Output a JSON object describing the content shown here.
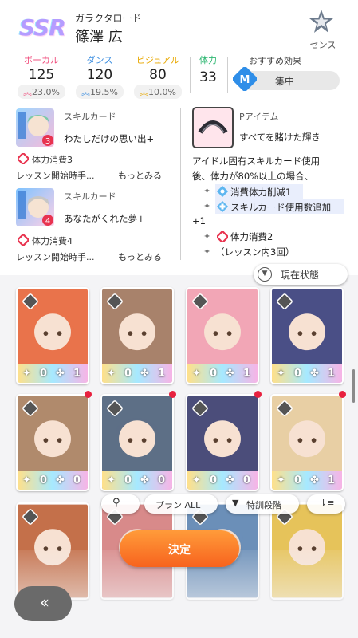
{
  "header": {
    "rarity": "SSR",
    "card_subname": "ガラクタロード",
    "card_name": "篠澤 広",
    "sense_label": "センス",
    "sense_icon": "sense-star-icon"
  },
  "stats": {
    "vocal": {
      "label": "ボーカル",
      "value": "125",
      "bonus": "23.0%"
    },
    "dance": {
      "label": "ダンス",
      "value": "120",
      "bonus": "19.5%"
    },
    "visual": {
      "label": "ビジュアル",
      "value": "80",
      "bonus": "10.0%"
    },
    "stamina": {
      "label": "体力",
      "value": "33"
    },
    "recommend": {
      "label": "おすすめ効果",
      "value": "集中"
    }
  },
  "skills": [
    {
      "type": "スキルカード",
      "name": "わたしだけの思い出+",
      "cost": "体力消費3",
      "timing": "レッスン開始時手...",
      "more": "もっとみる",
      "badge": "3"
    },
    {
      "type": "スキルカード",
      "name": "あなたがくれた夢+",
      "cost": "体力消費4",
      "timing": "レッスン開始時手...",
      "more": "もっとみる",
      "badge": "4"
    }
  ],
  "p_item": {
    "type": "Pアイテム",
    "name": "すべてを賭けた輝き",
    "desc1": "アイドル固有スキルカード使用",
    "desc2": "後、体力が80%以上の場合、",
    "effect1": "消費体力削減1",
    "effect2": "スキルカード使用数追加",
    "effect2_cont": "+1",
    "effect3": "体力消費2",
    "limit": "（レッスン内3回）"
  },
  "state_button": "現在状態",
  "cards": [
    {
      "v1": "0",
      "v2": "1",
      "dot": false,
      "color": "#e9734b"
    },
    {
      "v1": "0",
      "v2": "1",
      "dot": false,
      "color": "#a8826b"
    },
    {
      "v1": "0",
      "v2": "1",
      "dot": false,
      "color": "#f2a6b6"
    },
    {
      "v1": "0",
      "v2": "1",
      "dot": false,
      "color": "#4a4f86"
    },
    {
      "v1": "0",
      "v2": "0",
      "dot": true,
      "color": "#b08a6c"
    },
    {
      "v1": "0",
      "v2": "0",
      "dot": true,
      "color": "#5d6f86"
    },
    {
      "v1": "0",
      "v2": "0",
      "dot": true,
      "color": "#4b4d7a"
    },
    {
      "v1": "0",
      "v2": "1",
      "dot": true,
      "color": "#e8cfa4"
    },
    {
      "v1": "",
      "v2": "",
      "dot": false,
      "color": "#c4704a"
    },
    {
      "v1": "",
      "v2": "",
      "dot": false,
      "color": "#d88a8a"
    },
    {
      "v1": "",
      "v2": "",
      "dot": false,
      "color": "#6b8fb8"
    },
    {
      "v1": "",
      "v2": "",
      "dot": false,
      "color": "#e6c35a"
    }
  ],
  "filters": {
    "plan": "プラン ALL",
    "training": "特訓段階"
  },
  "confirm": "決定",
  "back": "‹‹"
}
